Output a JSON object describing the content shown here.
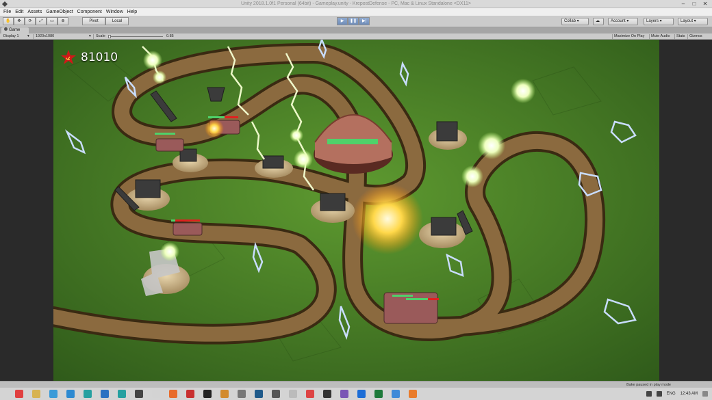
{
  "window": {
    "title": "Unity 2018.1.0f1 Personal (64bit) - Gameplay.unity - KrepostDefense - PC, Mac & Linux Standalone <DX11>"
  },
  "menu": [
    "File",
    "Edit",
    "Assets",
    "GameObject",
    "Component",
    "Window",
    "Help"
  ],
  "toolbar": {
    "pivot_label": "Pivot",
    "local_label": "Local",
    "collab_label": "Collab",
    "account_label": "Account",
    "layers_label": "Layers",
    "layout_label": "Layout"
  },
  "game_tab": {
    "label": "Game"
  },
  "game_toolbar": {
    "display": "Display 1",
    "resolution": "1920x1080",
    "scale_label": "Scale",
    "scale_value": "0.85",
    "maximize": "Maximize On Play",
    "mute": "Mute Audio",
    "stats": "Stats",
    "gizmos": "Gizmos"
  },
  "hud": {
    "score": "81010"
  },
  "status": {
    "message": "Bake paused in play mode"
  },
  "taskbar": {
    "lang": "ENG",
    "time": "12:43 AM"
  },
  "colors": {
    "grass": "#4f8c2b",
    "path": "#8b6a3f",
    "health": "#4fd16a",
    "accent_star": "#d01818"
  }
}
